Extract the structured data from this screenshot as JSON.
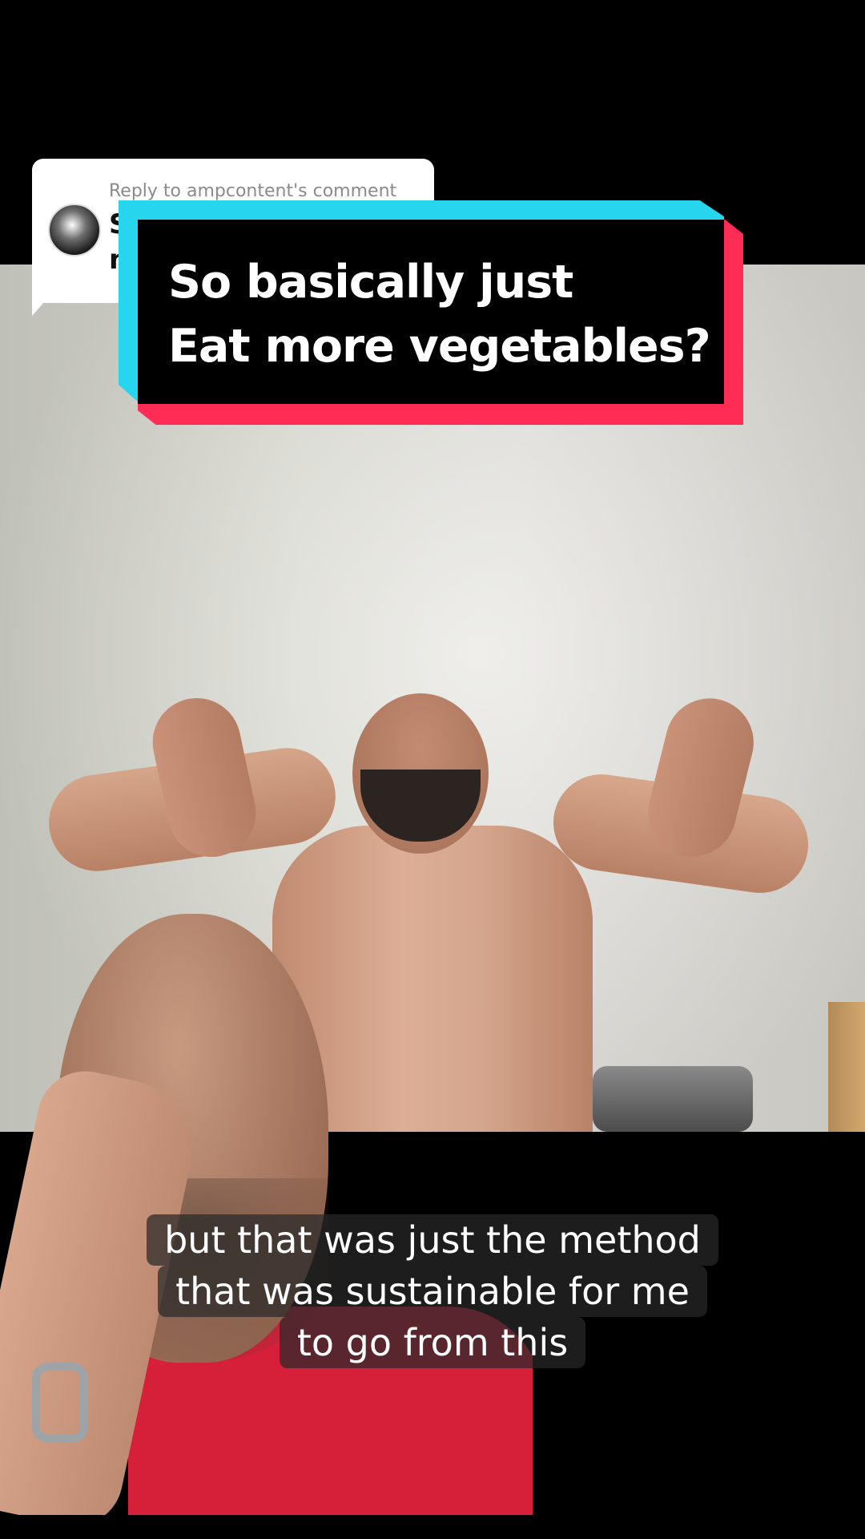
{
  "reply": {
    "label": "Reply to ampcontent's comment",
    "text": "S\nn"
  },
  "title": {
    "line1": "So basically just",
    "line2": "Eat more vegetables?"
  },
  "captions": {
    "line1": "but that was just the method",
    "line2": "that was sustainable for me",
    "line3": "to go from this"
  },
  "colors": {
    "sticker_cyan": "#27d5ec",
    "sticker_red": "#ff2c55",
    "sticker_black": "#000000",
    "caption_bg": "#282828"
  }
}
